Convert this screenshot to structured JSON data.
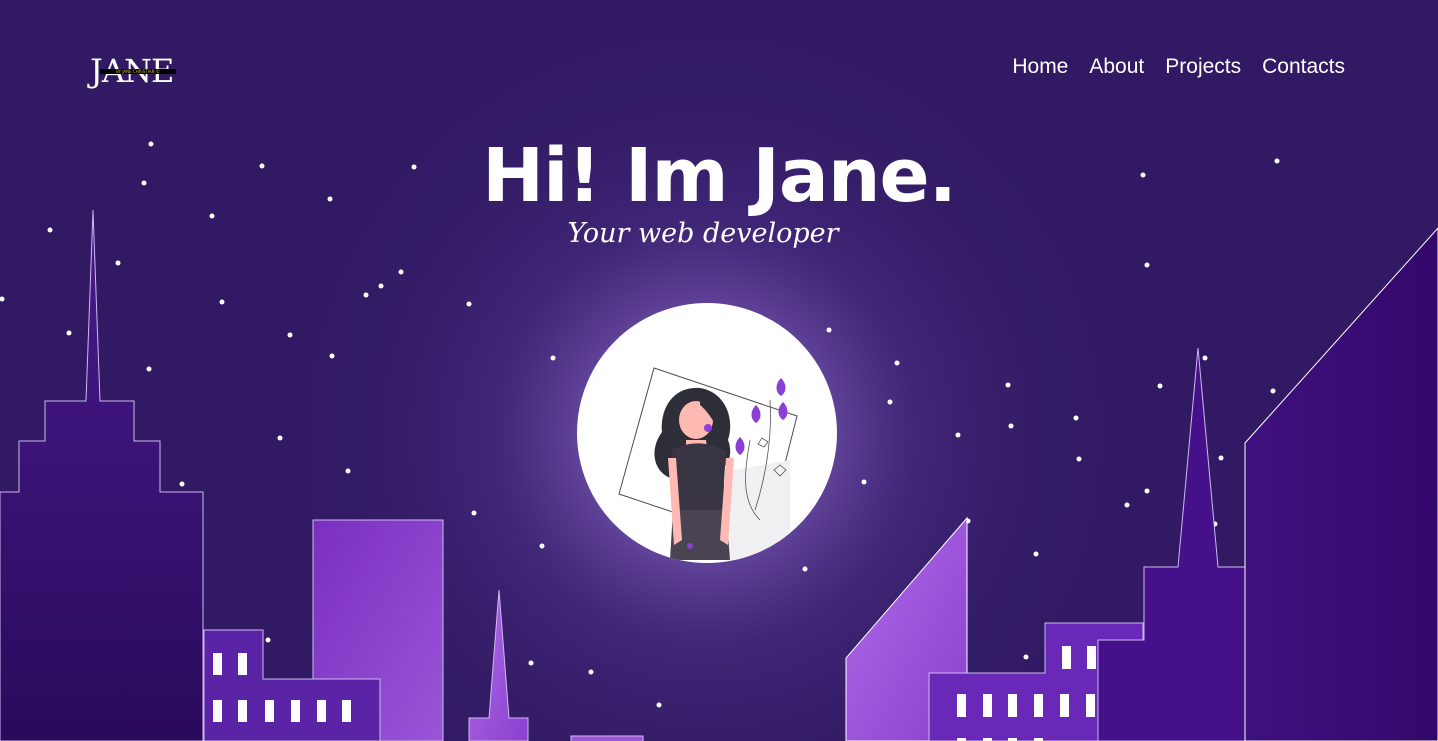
{
  "brand": {
    "logo_text": "JANE",
    "logo_subtext": "BY JANE CHRISTIAN ©"
  },
  "nav": {
    "items": [
      {
        "label": "Home"
      },
      {
        "label": "About"
      },
      {
        "label": "Projects"
      },
      {
        "label": "Contacts"
      }
    ]
  },
  "hero": {
    "title": "Hi! Im Jane.",
    "subtitle": "Your web developer"
  },
  "colors": {
    "sky": "#311a63",
    "building_dark": "#3a0c6e",
    "building_mid": "#5b24a6",
    "building_light": "#9a4ddc",
    "accent_purple": "#8a3fd6",
    "moon": "#ffffff",
    "text": "#ffffff"
  },
  "icons": {
    "portrait": "woman-portrait-illustration"
  }
}
